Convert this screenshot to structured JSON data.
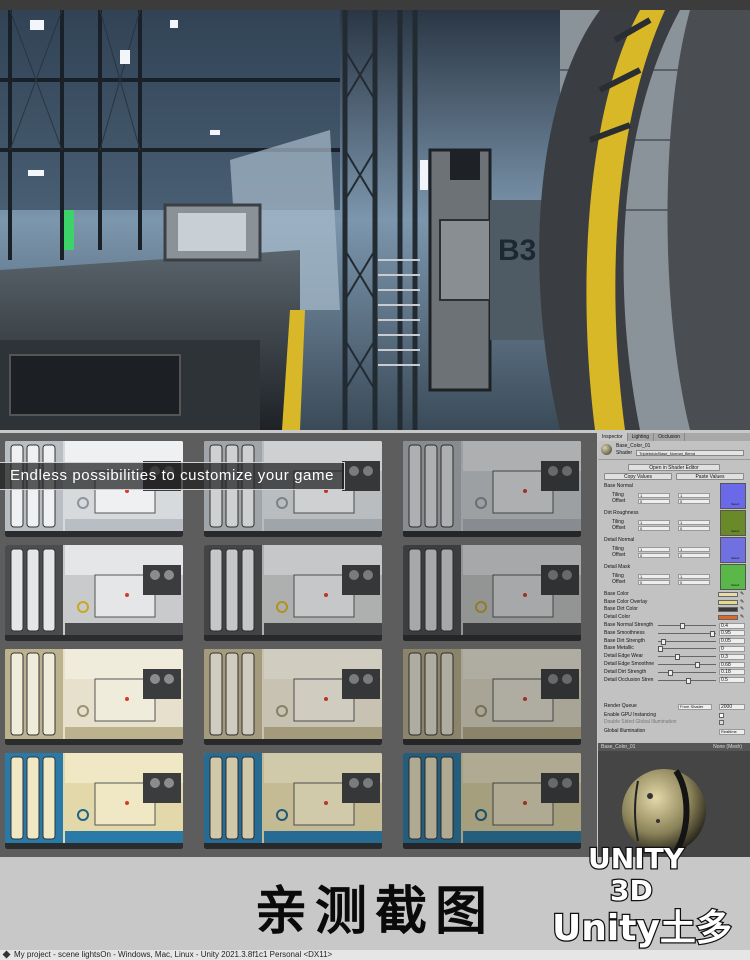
{
  "banner_text": "Endless possibilities to customize your game",
  "inspector": {
    "tabs": [
      "Inspector",
      "Lighting",
      "Occlusion"
    ],
    "material_name": "Base_Color_01",
    "shader_label": "Shader",
    "shader_value": "Triplebrick/Base_Normal_Blend",
    "open_editor_label": "Open in Shader Editor",
    "copy_values_label": "Copy Values",
    "paste_values_label": "Paste Values",
    "texture_sections": [
      {
        "label": "Base Normal",
        "tiling_x": "1",
        "tiling_y": "1",
        "offset_x": "0",
        "offset_y": "0",
        "select": "Select"
      },
      {
        "label": "Dirt Roughness",
        "tiling_x": "1",
        "tiling_y": "1",
        "offset_x": "0",
        "offset_y": "0",
        "select": "Select"
      },
      {
        "label": "Detail Normal",
        "tiling_x": "1",
        "tiling_y": "1",
        "offset_x": "0",
        "offset_y": "0",
        "select": "Select"
      },
      {
        "label": "Detail Mask",
        "tiling_x": "1",
        "tiling_y": "1",
        "offset_x": "0",
        "offset_y": "0",
        "select": "Select"
      }
    ],
    "tiling_label": "Tiling",
    "offset_label": "Offset",
    "color_props": [
      {
        "label": "Base Color",
        "color": "#e8dcae"
      },
      {
        "label": "Base Color Overlay",
        "color": "#e8d88a"
      },
      {
        "label": "Base Dirt Color",
        "color": "#3a3a3a"
      },
      {
        "label": "Detail Color",
        "color": "#e0662a"
      }
    ],
    "slider_props": [
      {
        "label": "Base Normal Strength",
        "value": "0.4",
        "level": 0.4
      },
      {
        "label": "Base Smoothness",
        "value": "0.95",
        "level": 0.95
      },
      {
        "label": "Base Dirt Strength",
        "value": "0.05",
        "level": 0.05
      },
      {
        "label": "Base Metallic",
        "value": "0",
        "level": 0
      },
      {
        "label": "Detail Edge Wear",
        "value": "0.3",
        "level": 0.3
      },
      {
        "label": "Detail Edge Smoothne",
        "value": "0.68",
        "level": 0.68
      },
      {
        "label": "Detail Dirt Strength",
        "value": "0.18",
        "level": 0.18
      },
      {
        "label": "Detail Occlusion Stren",
        "value": "0.5",
        "level": 0.5
      }
    ],
    "render_queue_label": "Render Queue",
    "render_queue_mode": "From Shader",
    "render_queue_value": "2000",
    "gpu_instancing_label": "Enable GPU Instancing",
    "double_sided_label": "Double Sided Global Illumination",
    "global_illumination_label": "Global Illumination",
    "global_illumination_value": "Realtime"
  },
  "preview": {
    "material_name": "Base_Color_01",
    "mesh_label": "None (Mesh)"
  },
  "caption": "亲测截图",
  "logo": {
    "line1": "UNITY",
    "line2": "3D",
    "line3": "Unity土多"
  },
  "status_bar": "My project - scene lightsOn - Windows, Mac, Linux - Unity 2021.3.8f1c1 Personal <DX11>",
  "colors": {
    "accent_yellow": "#e0c018",
    "panel_grey": "#c2c2c2",
    "scene_blue": "#3a5a78"
  }
}
